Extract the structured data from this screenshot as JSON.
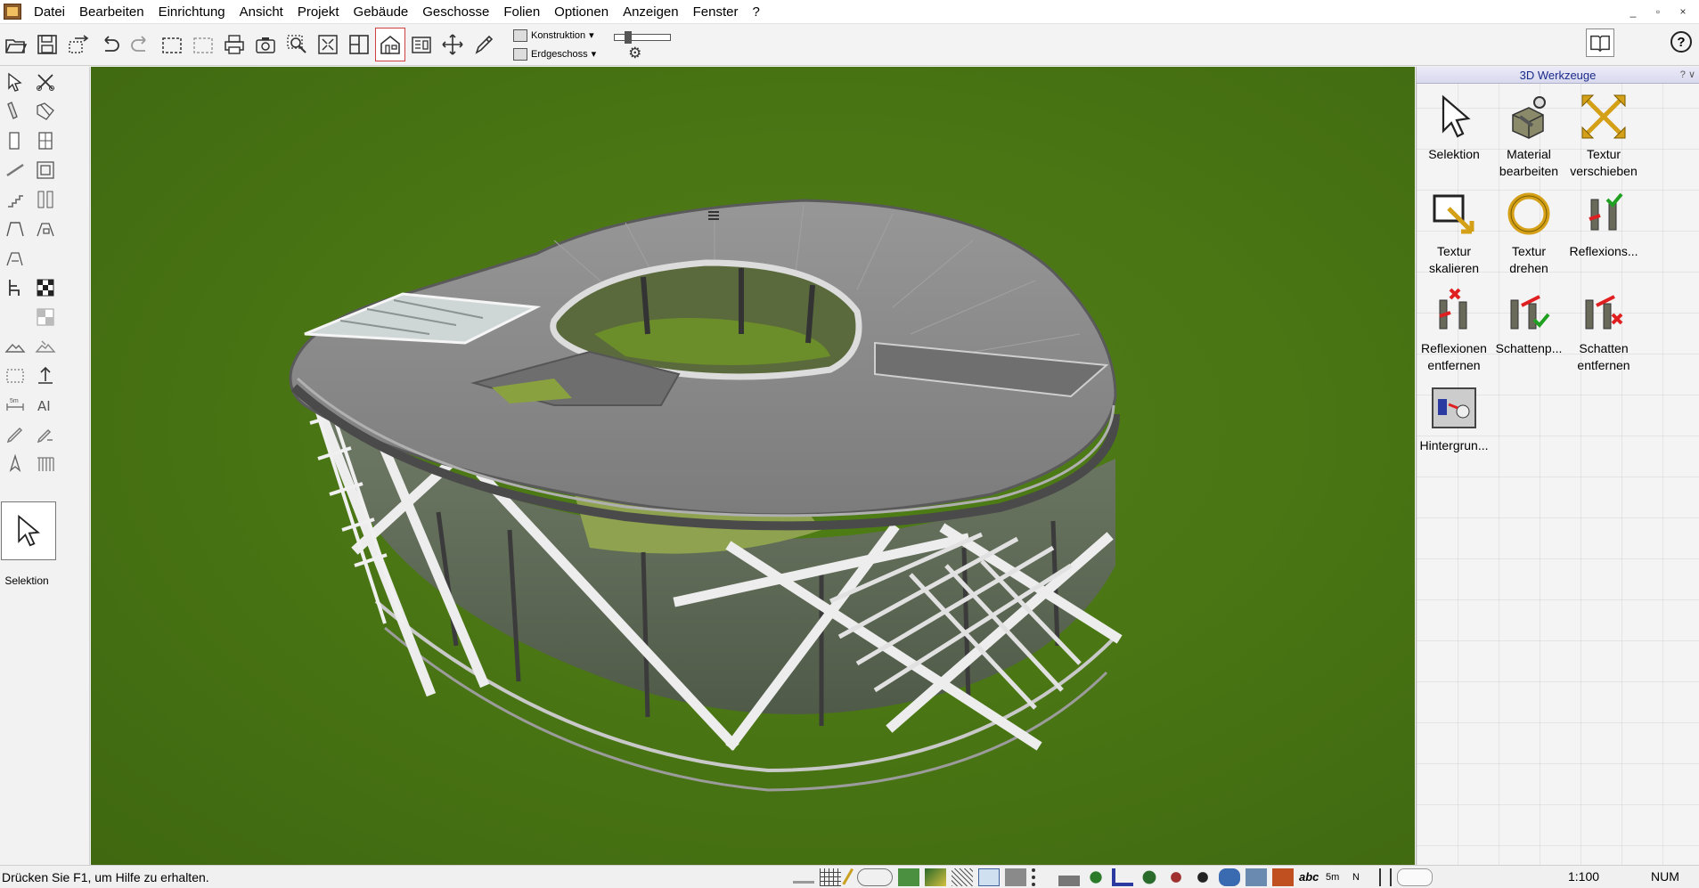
{
  "menu": {
    "items": [
      "Datei",
      "Bearbeiten",
      "Einrichtung",
      "Ansicht",
      "Projekt",
      "Gebäude",
      "Geschosse",
      "Folien",
      "Optionen",
      "Anzeigen",
      "Fenster",
      "?"
    ]
  },
  "window_controls": [
    "_",
    "▫",
    "×"
  ],
  "toolbar": {
    "layer_dropdown": "Konstruktion",
    "floor_dropdown": "Erdgeschoss"
  },
  "left_tools": {
    "current_tool_label": "Selektion"
  },
  "panel": {
    "title": "3D Werkzeuge",
    "controls": "? ∨",
    "tools": [
      {
        "label": "Selektion",
        "icon": "arrow-cursor-icon"
      },
      {
        "label": "Material bearbeiten",
        "icon": "material-edit-icon"
      },
      {
        "label": "Textur verschieben",
        "icon": "move-arrows-icon"
      },
      {
        "label": "Textur skalieren",
        "icon": "scale-texture-icon"
      },
      {
        "label": "Textur drehen",
        "icon": "rotate-texture-icon"
      },
      {
        "label": "Reflexions...",
        "icon": "reflection-add-icon"
      },
      {
        "label": "Reflexionen entfernen",
        "icon": "reflection-remove-icon"
      },
      {
        "label": "Schattenp...",
        "icon": "shadow-add-icon"
      },
      {
        "label": "Schatten entfernen",
        "icon": "shadow-remove-icon"
      },
      {
        "label": "Hintergrun...",
        "icon": "background-icon"
      }
    ]
  },
  "status": {
    "message": "Drücken Sie F1, um Hilfe zu erhalten.",
    "scale": "1:100",
    "num": "NUM"
  },
  "colors": {
    "grass": "#4a7614",
    "roof": "#8c8c8c",
    "panel_title": "#1a2a8a"
  }
}
